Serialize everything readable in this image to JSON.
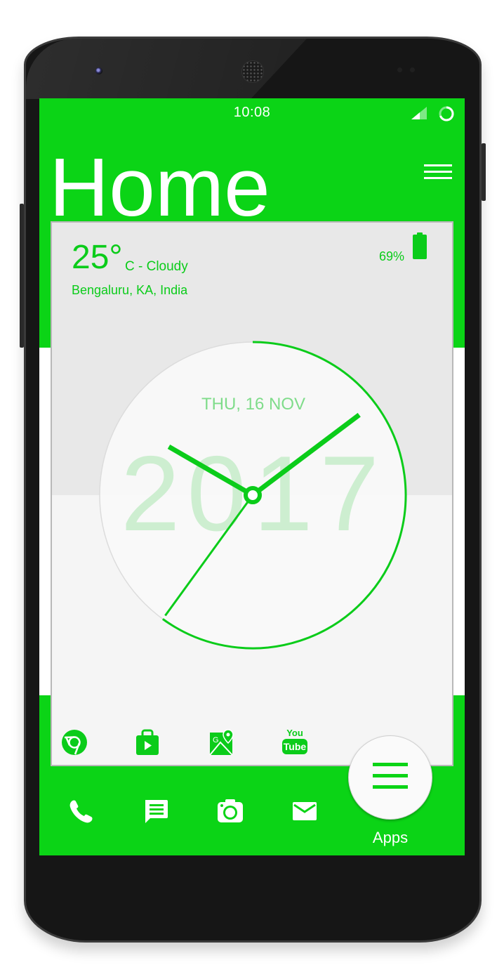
{
  "theme": {
    "accent": "#0bd416",
    "text_accent": "#0bcc1a",
    "date_color": "#7fdc8a",
    "year_color": "#cdeed0"
  },
  "status_bar": {
    "time": "10:08",
    "icons": [
      "signal-icon",
      "sync-icon"
    ]
  },
  "header": {
    "title": "Home",
    "menu_icon": "menu-icon"
  },
  "weather": {
    "temperature": "25°",
    "condition": "C - Cloudy",
    "location": "Bengaluru,  KA, India"
  },
  "battery": {
    "percent_label": "69%",
    "level": 0.69
  },
  "clock": {
    "date": "THU, 16 NOV",
    "year": "2017",
    "time": "10:08",
    "hour": 10,
    "minute": 8,
    "second": 38
  },
  "favorites": [
    {
      "name": "chrome",
      "icon": "chrome-icon"
    },
    {
      "name": "play-store",
      "icon": "play-store-icon"
    },
    {
      "name": "maps",
      "icon": "maps-icon"
    },
    {
      "name": "youtube",
      "icon": "youtube-icon",
      "top_text": "You",
      "bottom_text": "Tube"
    }
  ],
  "dock": [
    {
      "name": "phone",
      "icon": "phone-icon"
    },
    {
      "name": "messages",
      "icon": "message-icon"
    },
    {
      "name": "camera",
      "icon": "camera-icon"
    },
    {
      "name": "email",
      "icon": "mail-icon"
    }
  ],
  "apps_button": {
    "label": "Apps",
    "icon": "menu-icon"
  }
}
